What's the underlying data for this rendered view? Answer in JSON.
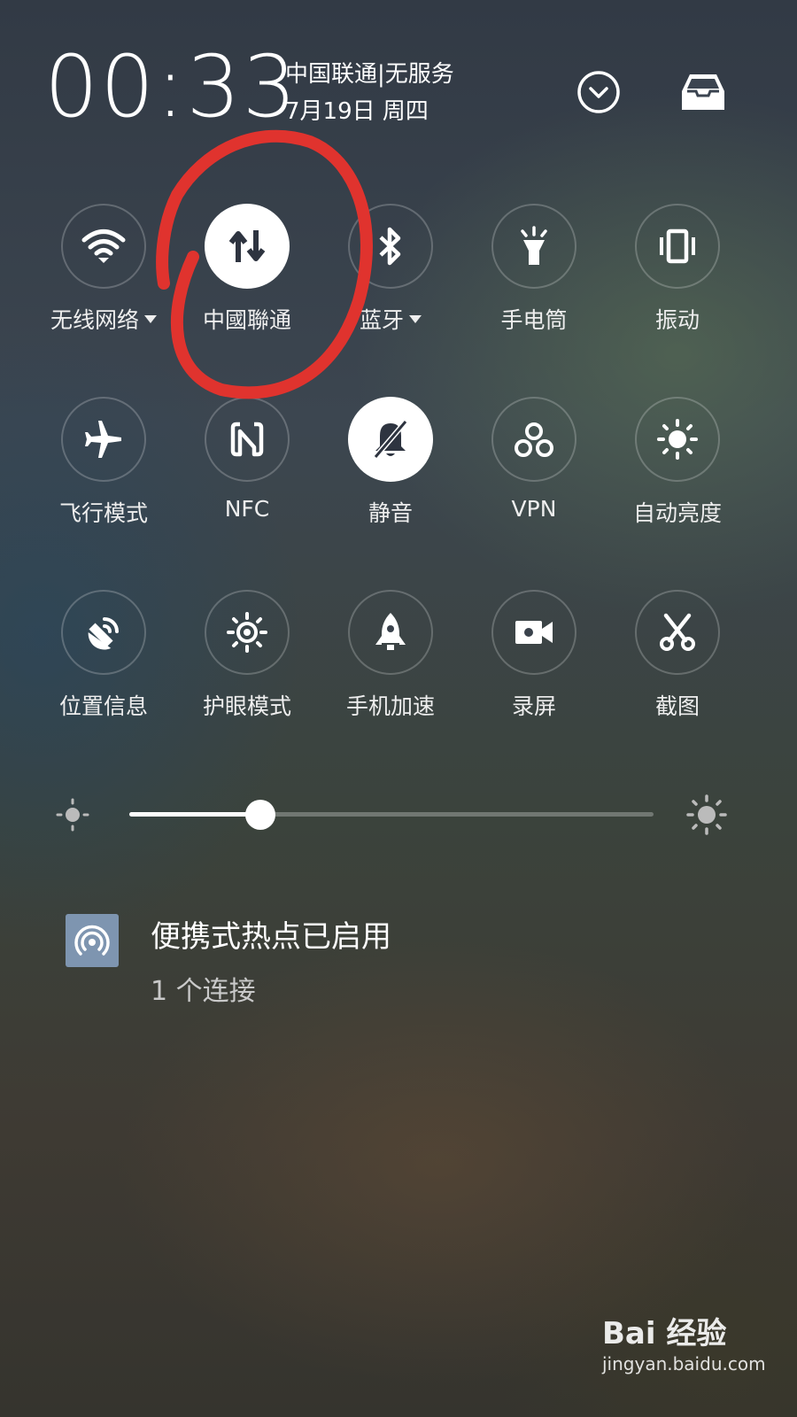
{
  "status": {
    "time": "00:33",
    "carrier": "中国联通|无服务",
    "date": "7月19日 周四"
  },
  "header": {
    "expand_icon": "chevron-down-circle-icon",
    "tray_icon": "inbox-tray-icon"
  },
  "tiles": [
    {
      "label": "无线网络",
      "icon": "wifi-icon",
      "active": false,
      "has_menu": true
    },
    {
      "label": "中國聯通",
      "icon": "mobile-data-icon",
      "active": true,
      "has_menu": false
    },
    {
      "label": "蓝牙",
      "icon": "bluetooth-icon",
      "active": false,
      "has_menu": true
    },
    {
      "label": "手电筒",
      "icon": "flashlight-icon",
      "active": false,
      "has_menu": false
    },
    {
      "label": "振动",
      "icon": "vibrate-icon",
      "active": false,
      "has_menu": false
    },
    {
      "label": "飞行模式",
      "icon": "airplane-icon",
      "active": false,
      "has_menu": false
    },
    {
      "label": "NFC",
      "icon": "nfc-icon",
      "active": false,
      "has_menu": false
    },
    {
      "label": "静音",
      "icon": "bell-off-icon",
      "active": true,
      "has_menu": false
    },
    {
      "label": "VPN",
      "icon": "vpn-icon",
      "active": false,
      "has_menu": false
    },
    {
      "label": "自动亮度",
      "icon": "auto-brightness-icon",
      "active": false,
      "has_menu": false
    },
    {
      "label": "位置信息",
      "icon": "location-icon",
      "active": false,
      "has_menu": false
    },
    {
      "label": "护眼模式",
      "icon": "eye-care-icon",
      "active": false,
      "has_menu": false
    },
    {
      "label": "手机加速",
      "icon": "rocket-icon",
      "active": false,
      "has_menu": false
    },
    {
      "label": "录屏",
      "icon": "screen-record-icon",
      "active": false,
      "has_menu": false
    },
    {
      "label": "截图",
      "icon": "screenshot-scissors-icon",
      "active": false,
      "has_menu": false
    }
  ],
  "brightness": {
    "level": 0.25,
    "low_icon": "brightness-low-icon",
    "high_icon": "brightness-high-icon"
  },
  "notification": {
    "icon": "hotspot-icon",
    "title": "便携式热点已启用",
    "subtitle": "1 个连接"
  },
  "annotation": {
    "highlight_color": "#e0332e"
  },
  "watermark": {
    "brand": "Bai 经验",
    "url": "jingyan.baidu.com"
  }
}
